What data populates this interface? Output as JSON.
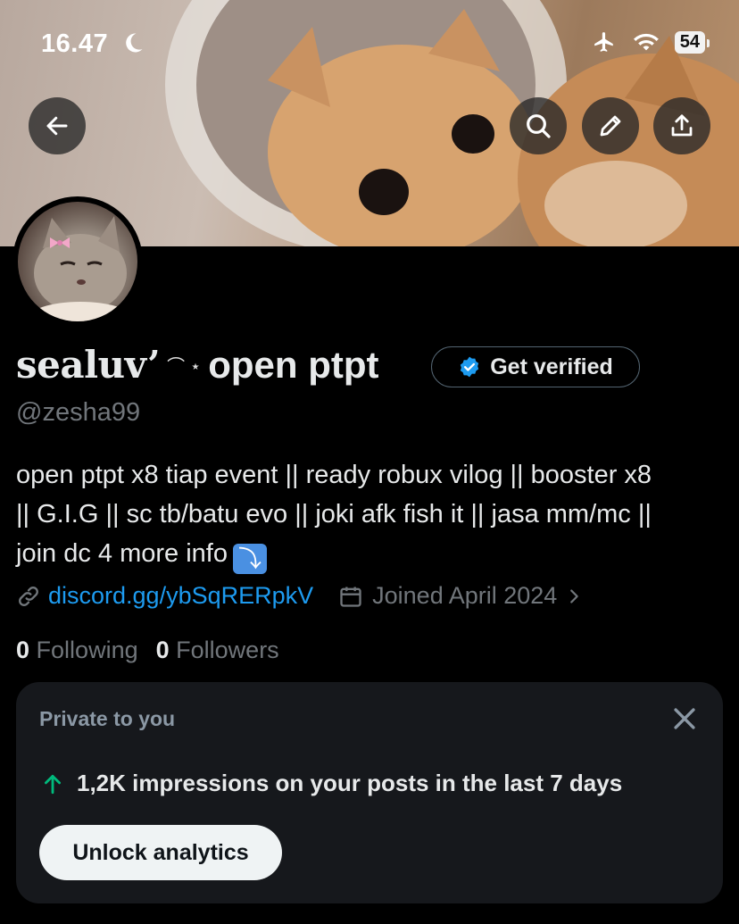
{
  "status_bar": {
    "time": "16.47",
    "battery": "54"
  },
  "profile": {
    "name_part1": "sealuv’",
    "name_deco": "⌒ ⋆",
    "name_part2": "open ptpt",
    "handle": "@zesha99",
    "get_verified_label": "Get verified",
    "bio_lines": [
      "open ptpt x8 tiap event || ready robux vilog || booster x8",
      "|| G.I.G || sc tb/batu evo || joki afk fish it || jasa mm/mc ||",
      "join dc 4 more info"
    ],
    "bio_emoji": "⤵",
    "link": "discord.gg/ybSqRERpkV",
    "joined": "Joined April 2024",
    "following_count": "0",
    "following_label": "Following",
    "followers_count": "0",
    "followers_label": "Followers"
  },
  "private_card": {
    "title": "Private to you",
    "stat": "1,2K impressions on your posts in the last 7 days",
    "button_label": "Unlock analytics"
  },
  "icons": {
    "back": "arrow-left-icon",
    "search": "search-icon",
    "edit": "pencil-icon",
    "share": "share-icon",
    "link": "link-icon",
    "calendar": "calendar-icon",
    "verified": "verified-badge-icon",
    "close": "close-icon",
    "trend": "arrow-up-icon"
  },
  "colors": {
    "accent": "#1d9bf0",
    "trend_green": "#00ba7c",
    "muted": "#71767b"
  }
}
